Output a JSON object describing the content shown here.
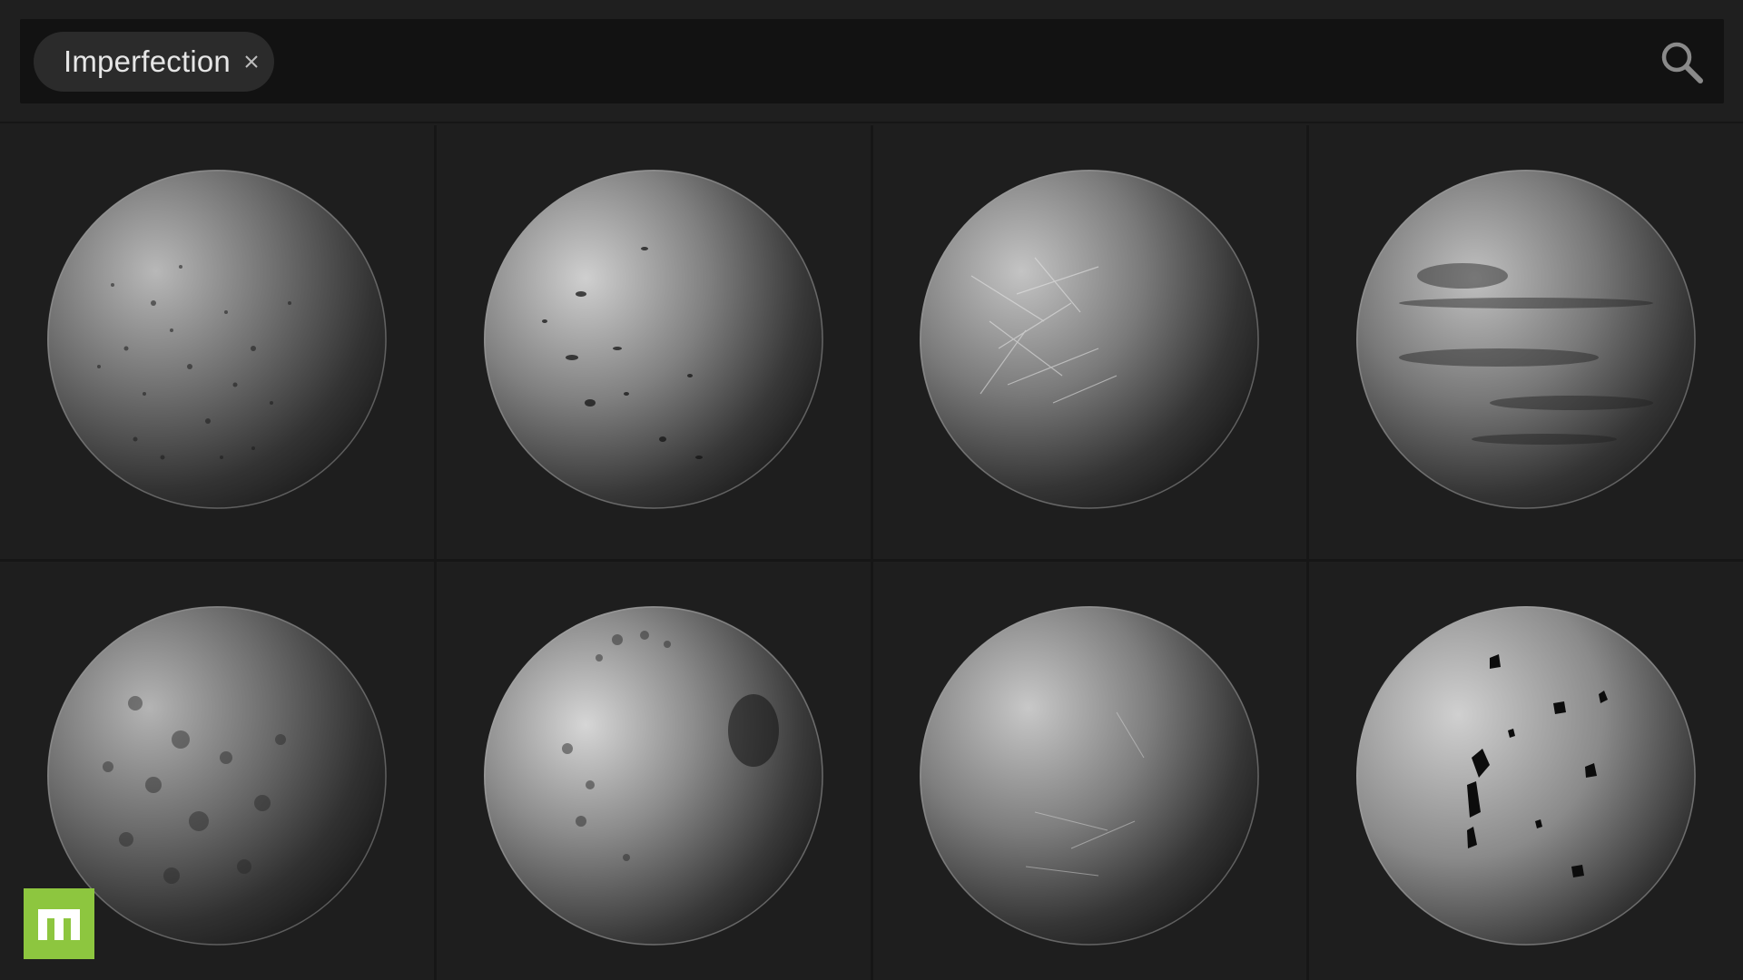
{
  "search": {
    "tag_label": "Imperfection",
    "remove_symbol": "×",
    "icon": "search-icon"
  },
  "materials": [
    {
      "id": 1,
      "style": "grunge-speckle"
    },
    {
      "id": 2,
      "style": "dirt-spots"
    },
    {
      "id": 3,
      "style": "scratches"
    },
    {
      "id": 4,
      "style": "smudges"
    },
    {
      "id": 5,
      "style": "mottled"
    },
    {
      "id": 6,
      "style": "blotches"
    },
    {
      "id": 7,
      "style": "fine-scratches"
    },
    {
      "id": 8,
      "style": "chips"
    }
  ],
  "brand": {
    "logo_icon": "brand-logo-icon",
    "color": "#8dc63f"
  },
  "colors": {
    "background": "#1e1e1e",
    "search_bar": "#121212",
    "chip": "#2b2b2b",
    "text": "#e6e6e6"
  }
}
